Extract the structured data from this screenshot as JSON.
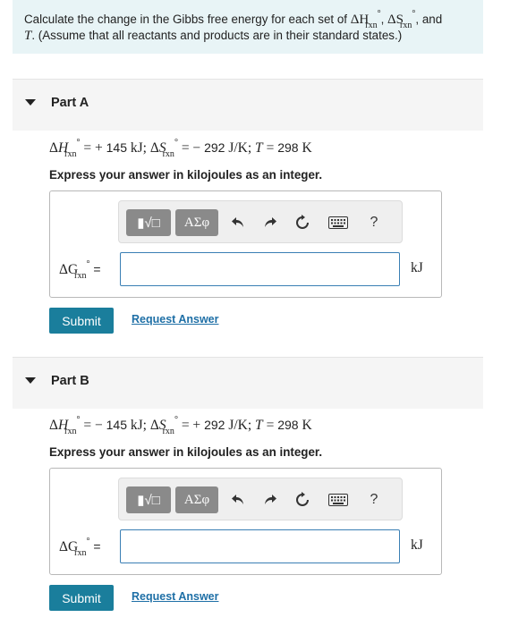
{
  "intro": {
    "text_1": "Calculate the change in the Gibbs free energy for each set of ",
    "dH": "ΔH",
    "dS": "ΔS",
    "T": "T",
    "sep": ", ",
    "and": ", and",
    "text_2": ". (Assume that all reactants and products are in their standard states.)",
    "degree": "°",
    "rxn": "rxn"
  },
  "toolbar": {
    "templates_label": "▮√□",
    "greek_label": "ΑΣφ",
    "undo_icon": "undo-icon",
    "redo_icon": "redo-icon",
    "reset_icon": "reset-icon",
    "keyboard_icon": "keyboard-icon",
    "help_label": "?"
  },
  "parts": [
    {
      "title": "Part A",
      "dH_sign": "= +",
      "dH_value": "145",
      "dH_unit": "kJ;",
      "dS_sign": "= −",
      "dS_value": "292",
      "dS_unit": "J/K;",
      "T_eq": "=",
      "T_value": "298",
      "T_unit": "K",
      "instruction": "Express your answer in kilojoules as an integer.",
      "answer_label": "ΔG",
      "answer_eq": "=",
      "answer_value": "",
      "answer_unit": "kJ",
      "submit_label": "Submit",
      "request_label": "Request Answer"
    },
    {
      "title": "Part B",
      "dH_sign": "= −",
      "dH_value": "145",
      "dH_unit": "kJ;",
      "dS_sign": "= +",
      "dS_value": "292",
      "dS_unit": "J/K;",
      "T_eq": "=",
      "T_value": "298",
      "T_unit": "K",
      "instruction": "Express your answer in kilojoules as an integer.",
      "answer_label": "ΔG",
      "answer_eq": "=",
      "answer_value": "",
      "answer_unit": "kJ",
      "submit_label": "Submit",
      "request_label": "Request Answer"
    }
  ]
}
